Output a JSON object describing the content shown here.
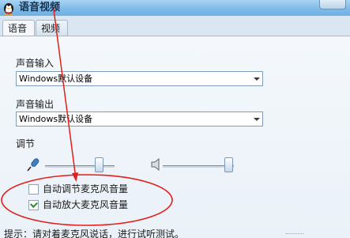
{
  "window": {
    "title": "语音视频",
    "logo_icon": "qq-penguin-icon"
  },
  "tabs": [
    {
      "label": "语音",
      "selected": true
    },
    {
      "label": "视频",
      "selected": false
    }
  ],
  "input_section": {
    "label": "声音输入",
    "device": "Windows默认设备"
  },
  "output_section": {
    "label": "声音输出",
    "device": "Windows默认设备"
  },
  "adjust_section": {
    "label": "调节",
    "mic_icon": "microphone-icon",
    "speaker_icon": "speaker-icon"
  },
  "options": [
    {
      "label": "自动调节麦克风音量",
      "checked": false
    },
    {
      "label": "自动放大麦克风音量",
      "checked": true
    }
  ],
  "hint": "提示：请对着麦克风说话，进行试听测试。",
  "annotation": {
    "color": "#e0201c"
  }
}
